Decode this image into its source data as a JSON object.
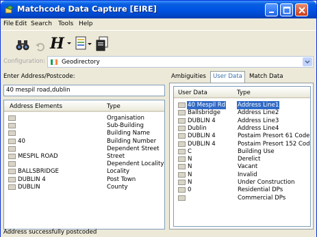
{
  "window": {
    "title": "Matchcode Data Capture [EIRE]"
  },
  "menu": {
    "items": [
      "File",
      "Edit",
      "Search",
      "Tools",
      "Help"
    ]
  },
  "toolbar": {
    "tools": [
      "binoculars-icon",
      "undo-icon",
      "h-icon",
      "list-icon",
      "document-icon"
    ]
  },
  "config": {
    "label": "Configuration:",
    "value": "Geodirectory",
    "flag_colors": [
      "#169b62",
      "#ffffff",
      "#ff883e"
    ]
  },
  "left": {
    "label": "Enter Address/Postcode:",
    "input_value": "40 mespil road,dublin",
    "columns": [
      "Address Elements",
      "Type"
    ],
    "rows": [
      {
        "element": "",
        "type": "Organisation"
      },
      {
        "element": "",
        "type": "Sub-Building"
      },
      {
        "element": "",
        "type": "Building Name"
      },
      {
        "element": "40",
        "type": "Building Number"
      },
      {
        "element": "",
        "type": "Dependent Street"
      },
      {
        "element": "MESPIL ROAD",
        "type": "Street"
      },
      {
        "element": "",
        "type": "Dependent Locality"
      },
      {
        "element": "BALLSBRIDGE",
        "type": "Locality"
      },
      {
        "element": "DUBLIN 4",
        "type": "Post Town"
      },
      {
        "element": "DUBLIN",
        "type": "County"
      }
    ]
  },
  "right": {
    "tabs": [
      "Ambiguities",
      "User Data",
      "Match Data"
    ],
    "active_tab": "User Data",
    "columns": [
      "User Data",
      "Type"
    ],
    "rows": [
      {
        "value": "40 Mespil Rd",
        "type": "Address Line1"
      },
      {
        "value": "Ballsbridge",
        "type": "Address Line2"
      },
      {
        "value": "DUBLIN 4",
        "type": "Address Line3"
      },
      {
        "value": "Dublin",
        "type": "Address Line4"
      },
      {
        "value": "DUBLIN 4",
        "type": "Postaim Presort 61 Code"
      },
      {
        "value": "DUBLIN 4",
        "type": "Postaim Presort 152 Code"
      },
      {
        "value": "C",
        "type": "Building Use"
      },
      {
        "value": "N",
        "type": "Derelict"
      },
      {
        "value": "N",
        "type": "Vacant"
      },
      {
        "value": "N",
        "type": "Invalid"
      },
      {
        "value": "N",
        "type": "Under Construction"
      },
      {
        "value": "0",
        "type": "Residential DPs"
      },
      {
        "value": "",
        "type": "Commercial DPs"
      }
    ],
    "selected_row": 0
  },
  "status": {
    "text": "Address successfully postcoded"
  }
}
